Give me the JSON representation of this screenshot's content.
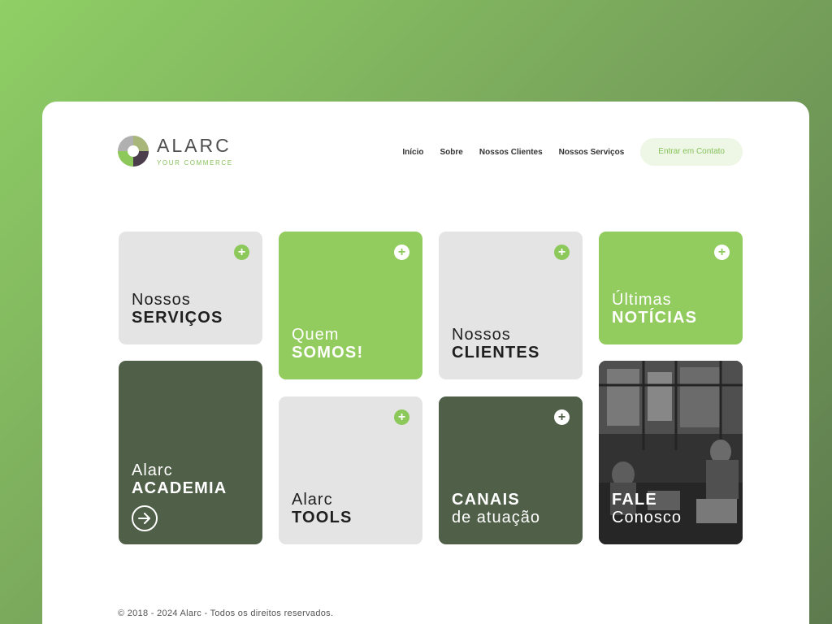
{
  "brand": {
    "name": "ALARC",
    "tagline": "YOUR COMMERCE",
    "colors": {
      "green": "#92cb5e",
      "dark": "#4f5f48",
      "gray": "#e4e4e4"
    }
  },
  "nav": {
    "items": [
      {
        "label": "Início"
      },
      {
        "label": "Sobre"
      },
      {
        "label": "Nossos Clientes"
      },
      {
        "label": "Nossos Serviços"
      }
    ],
    "cta_label": "Entrar em Contato"
  },
  "tiles": {
    "servicos": {
      "line1": "Nossos",
      "line2": "SERVIÇOS",
      "icon": "plus-icon"
    },
    "quem_somos": {
      "line1": "Quem",
      "line2": "SOMOS!",
      "icon": "plus-icon"
    },
    "clientes": {
      "line1": "Nossos",
      "line2": "CLIENTES",
      "icon": "plus-icon"
    },
    "noticias": {
      "line1": "Últimas",
      "line2": "NOTÍCIAS",
      "icon": "plus-icon"
    },
    "academia": {
      "line1": "Alarc",
      "line2": "ACADEMIA",
      "icon": "arrow-right-circle-icon"
    },
    "tools": {
      "line1": "Alarc",
      "line2": "TOOLS",
      "icon": "plus-icon"
    },
    "canais": {
      "line1": "CANAIS",
      "line2": "de atuação",
      "icon": "plus-icon"
    },
    "fale": {
      "line1": "FALE",
      "line2": "Conosco"
    }
  },
  "footer": {
    "text": "© 2018 - 2024 Alarc - Todos os direitos reservados."
  }
}
